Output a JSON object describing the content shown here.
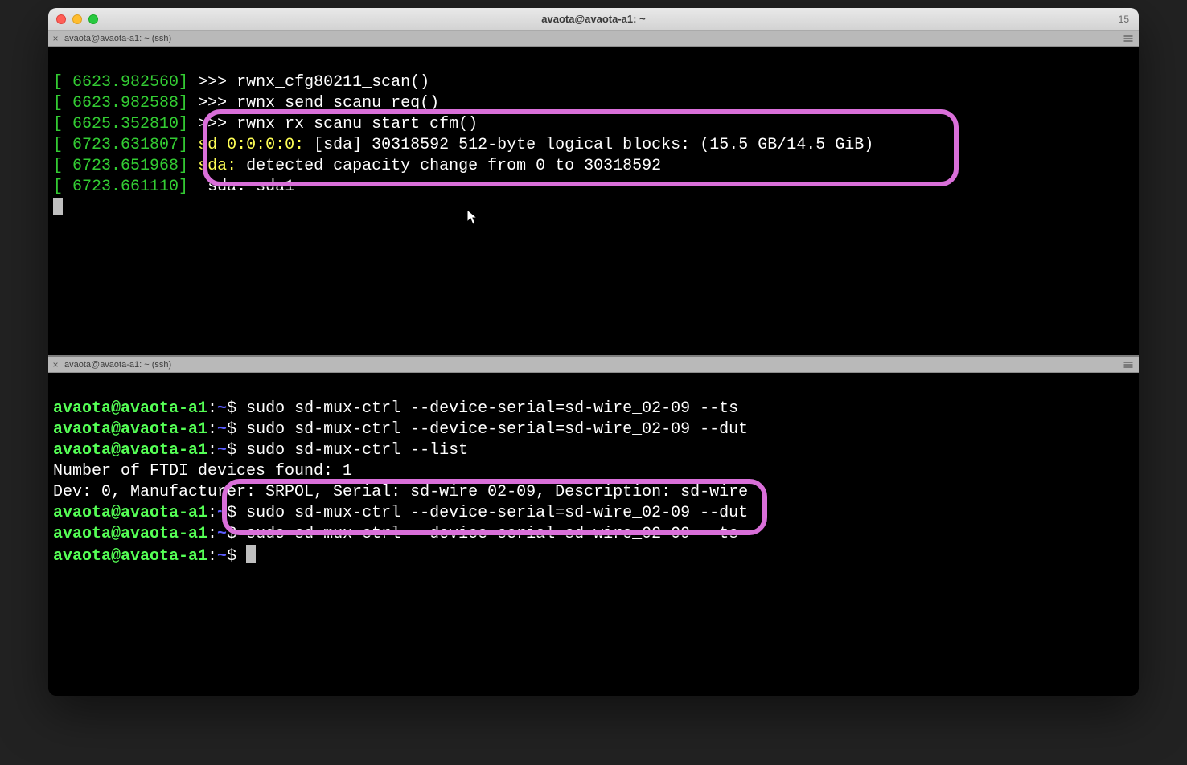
{
  "window": {
    "title": "avaota@avaota-a1: ~",
    "title_right": "15"
  },
  "tabs": {
    "top_label": "avaota@avaota-a1: ~ (ssh)",
    "bottom_label": "avaota@avaota-a1: ~ (ssh)"
  },
  "colors": {
    "bracket_green": "#33cc33",
    "yellow": "#ffff55",
    "prompt_green": "#55ff55",
    "prompt_blue": "#5c5cff",
    "highlight_pink": "#d96fd9"
  },
  "top_pane": {
    "lines": [
      {
        "ts": "6623.982560",
        "msg": ">>> rwnx_cfg80211_scan()"
      },
      {
        "ts": "6623.982588",
        "msg": ">>> rwnx_send_scanu_req()"
      },
      {
        "ts": "6625.352810",
        "msg": ">>> rwnx_rx_scanu_start_cfm()"
      },
      {
        "ts": "6723.631807",
        "yellow_prefix": "sd 0:0:0:0: ",
        "msg": "[sda] 30318592 512-byte logical blocks: (15.5 GB/14.5 GiB)"
      },
      {
        "ts": "6723.651968",
        "yellow_prefix": "sda: ",
        "msg": "detected capacity change from 0 to 30318592"
      },
      {
        "ts": "6723.661110",
        "msg": " sda: sda1"
      }
    ]
  },
  "bottom_pane": {
    "prompt_host": "avaota@avaota-a1",
    "prompt_path": "~",
    "entries": [
      {
        "cmd": "sudo sd-mux-ctrl --device-serial=sd-wire_02-09 --ts"
      },
      {
        "cmd": "sudo sd-mux-ctrl --device-serial=sd-wire_02-09 --dut"
      },
      {
        "cmd": "sudo sd-mux-ctrl --list"
      }
    ],
    "output": [
      "Number of FTDI devices found: 1",
      "Dev: 0, Manufacturer: SRPOL, Serial: sd-wire_02-09, Description: sd-wire"
    ],
    "entries2": [
      {
        "cmd": "sudo sd-mux-ctrl --device-serial=sd-wire_02-09 --dut"
      },
      {
        "cmd": "sudo sd-mux-ctrl --device-serial=sd-wire_02-09 --ts"
      }
    ]
  }
}
